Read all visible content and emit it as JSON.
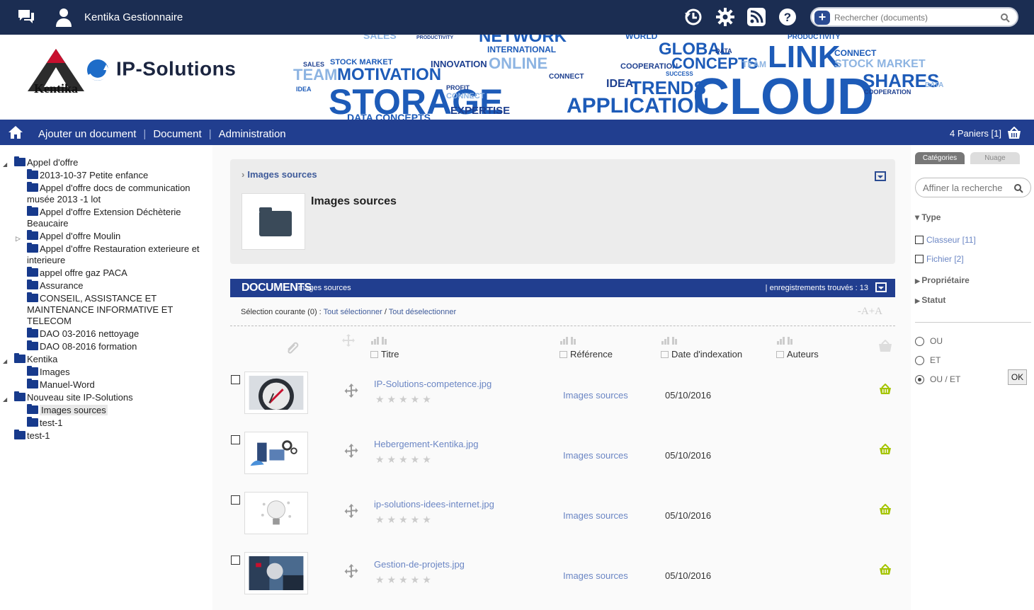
{
  "topbar": {
    "title": "Kentika Gestionnaire",
    "search_placeholder": "Rechercher (documents)"
  },
  "banner": {
    "brand": "IP-Solutions",
    "logo_text": "Kentika"
  },
  "nav": {
    "links": [
      "Ajouter un document",
      "Document",
      "Administration"
    ],
    "cart": "4 Paniers [1]"
  },
  "tree": [
    {
      "label": "Appel d'offre",
      "level": 0,
      "exp": "open"
    },
    {
      "label": "2013-10-37 Petite enfance",
      "level": 1
    },
    {
      "label": "Appel d'offre docs de communication musée 2013 -1 lot",
      "level": 1
    },
    {
      "label": "Appel d'offre Extension Déchèterie Beaucaire",
      "level": 1
    },
    {
      "label": "Appel d'offre Moulin",
      "level": 1,
      "exp": "closed"
    },
    {
      "label": "Appel d'offre Restauration exterieure et interieure",
      "level": 1
    },
    {
      "label": "appel offre gaz PACA",
      "level": 1
    },
    {
      "label": "Assurance",
      "level": 1
    },
    {
      "label": "CONSEIL, ASSISTANCE ET MAINTENANCE INFORMATIVE ET TELECOM",
      "level": 1
    },
    {
      "label": "DAO 03-2016 nettoyage",
      "level": 1
    },
    {
      "label": "DAO 08-2016 formation",
      "level": 1
    },
    {
      "label": "Kentika",
      "level": 0,
      "exp": "open"
    },
    {
      "label": "Images",
      "level": 1
    },
    {
      "label": "Manuel-Word",
      "level": 1
    },
    {
      "label": "Nouveau site IP-Solutions",
      "level": 0,
      "exp": "open"
    },
    {
      "label": "Images sources",
      "level": 1,
      "selected": true
    },
    {
      "label": "test-1",
      "level": 1
    },
    {
      "label": "test-1",
      "level": 0
    }
  ],
  "folder": {
    "breadcrumb": "Images sources",
    "title": "Images sources"
  },
  "docs": {
    "header": "DOCUMENTS",
    "sub": "Images sources",
    "count": "| enregistrements trouvés : 13",
    "selection_prefix": "Sélection courante (0) : ",
    "select_all": "Tout sélectionner",
    "deselect_all": "Tout déselectionner",
    "fontsize": "-A+A",
    "columns": [
      "Titre",
      "Référence",
      "Date d'indexation",
      "Auteurs"
    ],
    "rows": [
      {
        "title": "IP-Solutions-competence.jpg",
        "ref": "Images sources",
        "date": "05/10/2016",
        "thumb": "compass"
      },
      {
        "title": "Hebergement-Kentika.jpg",
        "ref": "Images sources",
        "date": "05/10/2016",
        "thumb": "server"
      },
      {
        "title": "ip-solutions-idees-internet.jpg",
        "ref": "Images sources",
        "date": "05/10/2016",
        "thumb": "bulb"
      },
      {
        "title": "Gestion-de-projets.jpg",
        "ref": "Images sources",
        "date": "05/10/2016",
        "thumb": "project"
      }
    ]
  },
  "sidebar": {
    "tab_categories": "Catégories",
    "tab_nuage": "Nuage",
    "filter_placeholder": "Affiner la recherche",
    "type_label": "Type",
    "types": [
      "Classeur [11]",
      "Fichier [2]"
    ],
    "sections": [
      "Propriétaire",
      "Statut"
    ],
    "operators": [
      "OU",
      "ET",
      "OU / ET"
    ],
    "selected_operator": "OU / ET",
    "ok": "OK"
  },
  "colors": {
    "topbar": "#1b2d52",
    "nav": "#213e8f",
    "link": "#6b86c4",
    "basket": "#a4c400"
  }
}
